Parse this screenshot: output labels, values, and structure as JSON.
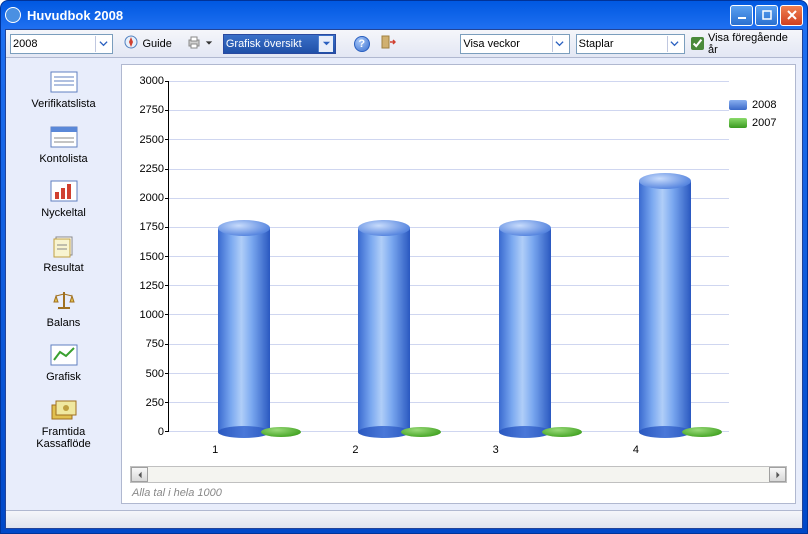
{
  "window": {
    "title": "Huvudbok 2008"
  },
  "toolbar": {
    "year": "2008",
    "guide_label": "Guide",
    "view_select": "Grafisk översikt",
    "time_select": "Visa veckor",
    "chart_type": "Staplar",
    "prev_year_checkbox": "Visa föregående år"
  },
  "sidebar": {
    "items": [
      {
        "label": "Verifikatslista"
      },
      {
        "label": "Kontolista"
      },
      {
        "label": "Nyckeltal"
      },
      {
        "label": "Resultat"
      },
      {
        "label": "Balans"
      },
      {
        "label": "Grafisk"
      },
      {
        "label": "Framtida\nKassaflöde"
      }
    ]
  },
  "legend": {
    "series1": "2008",
    "series2": "2007"
  },
  "footnote": "Alla tal i hela 1000",
  "chart_data": {
    "type": "bar",
    "categories": [
      "1",
      "2",
      "3",
      "4"
    ],
    "series": [
      {
        "name": "2008",
        "values": [
          1750,
          1750,
          1750,
          2150
        ]
      },
      {
        "name": "2007",
        "values": [
          0,
          0,
          0,
          0
        ]
      }
    ],
    "ylabel": "",
    "xlabel": "",
    "ylim": [
      0,
      3000
    ],
    "yticks": [
      0,
      250,
      500,
      750,
      1000,
      1250,
      1500,
      1750,
      2000,
      2250,
      2500,
      2750,
      3000
    ]
  }
}
